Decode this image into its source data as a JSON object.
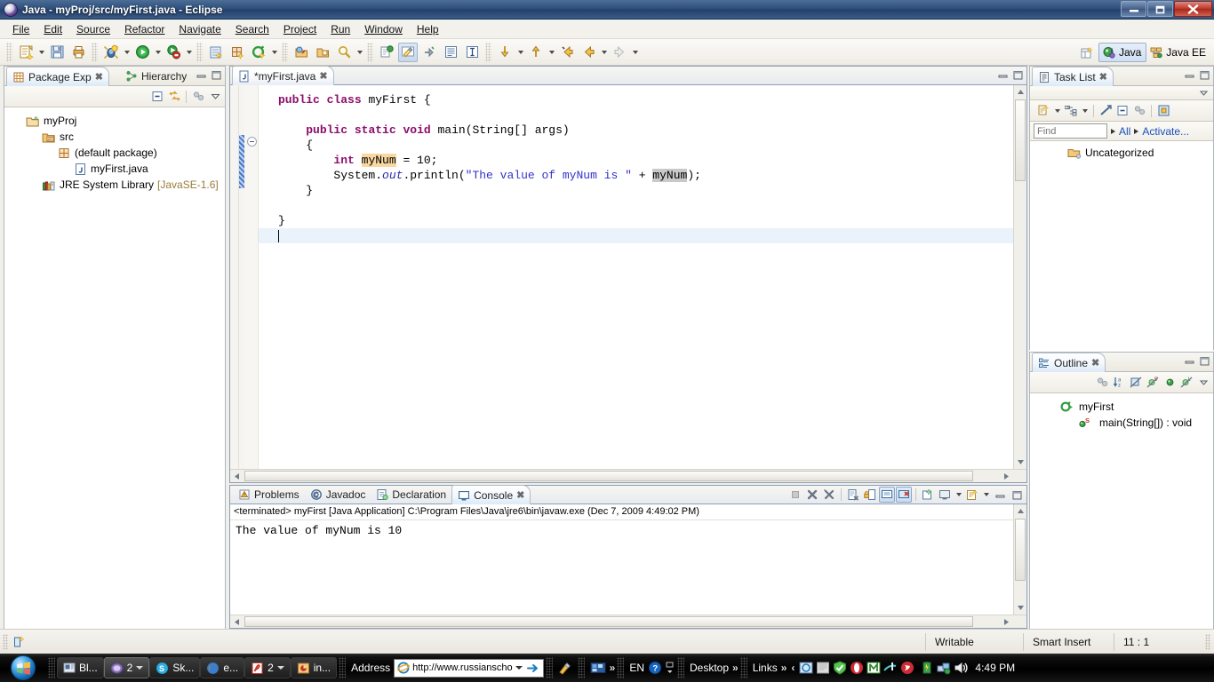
{
  "window": {
    "title": "Java - myProj/src/myFirst.java - Eclipse",
    "app_icon": "eclipse-icon",
    "controls": {
      "minimize": "minimize-button",
      "restore": "restore-button",
      "close": "close-button"
    }
  },
  "menubar": {
    "items": [
      "File",
      "Edit",
      "Source",
      "Refactor",
      "Navigate",
      "Search",
      "Project",
      "Run",
      "Window",
      "Help"
    ]
  },
  "toolbar": {
    "groups": [
      {
        "buttons": [
          {
            "icon": "new-wizard-icon",
            "dropdown": true
          },
          {
            "icon": "save-icon",
            "dropdown": false
          },
          {
            "icon": "print-icon",
            "dropdown": false
          }
        ]
      },
      {
        "buttons": [
          {
            "icon": "debug-icon",
            "dropdown": true
          },
          {
            "icon": "run-icon",
            "dropdown": true
          },
          {
            "icon": "external-tools-icon",
            "dropdown": true
          }
        ]
      },
      {
        "buttons": [
          {
            "icon": "new-java-project-icon",
            "dropdown": false
          },
          {
            "icon": "new-package-icon",
            "dropdown": false
          },
          {
            "icon": "new-class-icon",
            "dropdown": true
          }
        ]
      },
      {
        "buttons": [
          {
            "icon": "open-type-icon",
            "dropdown": false
          },
          {
            "icon": "open-task-icon",
            "dropdown": false
          },
          {
            "icon": "search-icon",
            "dropdown": true
          }
        ]
      },
      {
        "buttons": [
          {
            "icon": "toggle-mark-occurrences-icon",
            "dropdown": false
          },
          {
            "icon": "pencil-highlight-icon",
            "dropdown": false,
            "pressed": true
          },
          {
            "icon": "skip-breakpoints-icon",
            "dropdown": false
          },
          {
            "icon": "show-whitespace-icon",
            "dropdown": false
          },
          {
            "icon": "block-selection-icon",
            "dropdown": false
          }
        ]
      },
      {
        "buttons": [
          {
            "icon": "next-annotation-icon",
            "dropdown": true
          },
          {
            "icon": "previous-annotation-icon",
            "dropdown": true
          },
          {
            "icon": "last-edit-location-icon",
            "dropdown": false
          },
          {
            "icon": "back-icon",
            "dropdown": true
          },
          {
            "icon": "forward-icon",
            "dropdown": true
          }
        ]
      }
    ],
    "perspectives": {
      "open_icon": "open-perspective-icon",
      "items": [
        {
          "label": "Java",
          "icon": "java-perspective-icon",
          "active": true
        },
        {
          "label": "Java EE",
          "icon": "javaee-perspective-icon",
          "active": false
        }
      ]
    }
  },
  "package_explorer": {
    "tabs": [
      {
        "label": "Package Exp",
        "icon": "package-explorer-icon",
        "selected": true,
        "closeable": true
      },
      {
        "label": "Hierarchy",
        "icon": "hierarchy-icon",
        "selected": false,
        "closeable": false
      }
    ],
    "view_controls": [
      "minimize-view-icon",
      "maximize-view-icon"
    ],
    "toolbar_icons": [
      "collapse-all-icon",
      "link-with-editor-icon",
      "focus-on-active-task-icon",
      "view-menu-icon"
    ],
    "tree": [
      {
        "label": "myProj",
        "icon": "java-project-icon",
        "indent": 0,
        "suffix": ""
      },
      {
        "label": "src",
        "icon": "source-folder-icon",
        "indent": 1,
        "suffix": ""
      },
      {
        "label": "(default package)",
        "icon": "package-icon",
        "indent": 2,
        "suffix": ""
      },
      {
        "label": "myFirst.java",
        "icon": "java-file-icon",
        "indent": 3,
        "suffix": ""
      },
      {
        "label": "JRE System Library",
        "icon": "library-icon",
        "indent": 1,
        "suffix": "[JavaSE-1.6]"
      }
    ]
  },
  "editor": {
    "tab": {
      "label": "*myFirst.java",
      "icon": "java-file-icon",
      "dirty": true,
      "closeable": true
    },
    "controls": [
      "minimize-editor-icon",
      "maximize-editor-icon"
    ],
    "caret_position": "11 : 1",
    "lines": [
      {
        "n": 1,
        "segments": [
          {
            "t": "public",
            "c": "kw"
          },
          {
            "t": " ",
            "c": ""
          },
          {
            "t": "class",
            "c": "kw"
          },
          {
            "t": " myFirst {",
            "c": ""
          }
        ]
      },
      {
        "n": 2,
        "segments": []
      },
      {
        "n": 3,
        "segments": [
          {
            "t": "    ",
            "c": ""
          },
          {
            "t": "public",
            "c": "kw"
          },
          {
            "t": " ",
            "c": ""
          },
          {
            "t": "static",
            "c": "kw"
          },
          {
            "t": " ",
            "c": ""
          },
          {
            "t": "void",
            "c": "kw"
          },
          {
            "t": " main(String[] args)",
            "c": ""
          }
        ]
      },
      {
        "n": 4,
        "segments": [
          {
            "t": "    {",
            "c": ""
          }
        ]
      },
      {
        "n": 5,
        "segments": [
          {
            "t": "        ",
            "c": ""
          },
          {
            "t": "int",
            "c": "kw"
          },
          {
            "t": " ",
            "c": ""
          },
          {
            "t": "myNum",
            "c": "hl-occ"
          },
          {
            "t": " = 10;",
            "c": ""
          }
        ]
      },
      {
        "n": 6,
        "segments": [
          {
            "t": "        System.",
            "c": ""
          },
          {
            "t": "out",
            "c": "fld"
          },
          {
            "t": ".println(",
            "c": ""
          },
          {
            "t": "\"The value of myNum is \"",
            "c": "str"
          },
          {
            "t": " + ",
            "c": ""
          },
          {
            "t": "myNum",
            "c": "hl-sel"
          },
          {
            "t": ");",
            "c": ""
          }
        ]
      },
      {
        "n": 7,
        "segments": [
          {
            "t": "    }",
            "c": ""
          }
        ]
      },
      {
        "n": 8,
        "segments": []
      },
      {
        "n": 9,
        "segments": []
      },
      {
        "n": 10,
        "segments": [
          {
            "t": "}",
            "c": ""
          }
        ]
      },
      {
        "n": 11,
        "segments": [],
        "current": true
      }
    ]
  },
  "bottom_panel": {
    "tabs": [
      {
        "label": "Problems",
        "icon": "problems-icon",
        "selected": false
      },
      {
        "label": "Javadoc",
        "icon": "javadoc-icon",
        "selected": false
      },
      {
        "label": "Declaration",
        "icon": "declaration-icon",
        "selected": false
      },
      {
        "label": "Console",
        "icon": "console-icon",
        "selected": true,
        "closeable": true
      }
    ],
    "toolbar_icons": [
      "terminate-icon",
      "remove-launch-icon",
      "remove-all-terminated-icon",
      "clear-console-icon",
      "lock-scroll-icon",
      "show-console-on-output-icon",
      "show-console-on-error-icon",
      "pin-console-icon",
      "display-selected-console-icon",
      "open-console-icon"
    ],
    "controls": [
      "minimize-panel-icon",
      "maximize-panel-icon"
    ],
    "console": {
      "process_line": "<terminated> myFirst [Java Application] C:\\Program Files\\Java\\jre6\\bin\\javaw.exe (Dec 7, 2009 4:49:02 PM)",
      "output": "The value of myNum is 10"
    }
  },
  "task_list": {
    "tab": {
      "label": "Task List",
      "icon": "task-list-icon",
      "closeable": true
    },
    "controls": [
      "minimize-view-icon",
      "maximize-view-icon"
    ],
    "menu_icon": "view-menu-icon",
    "toolbar_icons": [
      "new-task-icon",
      "categorize-icon",
      "synchronize-icon",
      "collapse-all-icon",
      "focus-on-workweek-icon",
      "restore-tasks-icon"
    ],
    "find": {
      "placeholder": "Find",
      "value": ""
    },
    "filters": [
      {
        "label": "All",
        "icon": "filter-arrow-icon"
      },
      {
        "label": "Activate...",
        "icon": "filter-arrow-icon"
      }
    ],
    "items": [
      {
        "label": "Uncategorized",
        "icon": "category-folder-icon"
      }
    ]
  },
  "outline": {
    "tab": {
      "label": "Outline",
      "icon": "outline-icon",
      "closeable": true
    },
    "controls": [
      "minimize-view-icon",
      "maximize-view-icon"
    ],
    "toolbar_icons": [
      "focus-on-active-task-icon",
      "sort-icon",
      "hide-fields-icon",
      "hide-static-icon",
      "hide-nonpublic-icon",
      "hide-local-types-icon",
      "view-menu-icon"
    ],
    "items": [
      {
        "label": "myFirst",
        "icon": "class-icon",
        "indent": 0
      },
      {
        "label": "main(String[]) : void",
        "icon": "public-method-icon",
        "indent": 1,
        "badge": "S"
      }
    ]
  },
  "status_bar": {
    "fast_view_icon": "new-fast-view-icon",
    "cells": [
      "Writable",
      "Smart Insert",
      "11 : 1"
    ]
  },
  "taskbar": {
    "start_icon": "windows-start-orb",
    "buttons": [
      {
        "label": "Bl...",
        "icon": "bluetooth-window-icon",
        "active": false,
        "dropdown": false
      },
      {
        "label": "2",
        "icon": "eclipse-group-icon",
        "active": true,
        "dropdown": true
      },
      {
        "label": "Sk...",
        "icon": "skype-icon",
        "active": false,
        "dropdown": false
      },
      {
        "label": "e...",
        "icon": "firefox-icon",
        "active": false,
        "dropdown": false
      },
      {
        "label": "2",
        "icon": "acrobat-group-icon",
        "active": false,
        "dropdown": true
      },
      {
        "label": "in...",
        "icon": "powerpoint-icon",
        "active": false,
        "dropdown": false
      }
    ],
    "address_toolbar": {
      "label": "Address",
      "icon": "internet-explorer-icon",
      "url": "http://www.russianscho",
      "go_icon": "go-arrow-icon"
    },
    "quick_icons": [
      "edit-icon",
      "show-desktop-icon"
    ],
    "overflow_chevron": "»",
    "language": "EN",
    "help_icon": "help-icon",
    "toolbars": [
      {
        "label": "Desktop",
        "chevron": "»"
      },
      {
        "label": "Links",
        "chevron": "»"
      }
    ],
    "tray_expand": "‹",
    "tray_icons": [
      "ie-tray-icon",
      "update-tray-icon",
      "antivirus-shield-icon",
      "opera-tray-icon",
      "messenger-tray-icon",
      "network-tray-icon",
      "media-tray-icon",
      "power-tray-icon",
      "network-status-icon",
      "volume-icon"
    ],
    "clock": "4:49 PM"
  },
  "colors": {
    "titlebar": "#2d4e78",
    "accent": "#1a4fbf",
    "keyword": "#8b0d6b",
    "string": "#3232cd",
    "field": "#2a2aa8",
    "occurrence_highlight": "#f8d8a0",
    "selection_highlight": "#c9c9c9",
    "current_line": "#eaf2fb",
    "close_button": "#c0372a"
  }
}
